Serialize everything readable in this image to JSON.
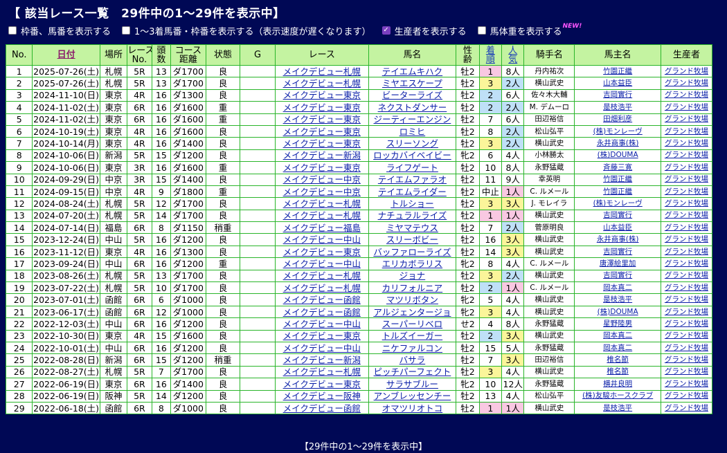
{
  "title": "【 該当レース一覧　29件中の1〜29件を表示中】",
  "options": [
    {
      "label": "枠番、馬番を表示する",
      "checked": false
    },
    {
      "label": "1〜3着馬番・枠番を表示する（表示速度が遅くなります）",
      "checked": false
    },
    {
      "label": "生産者を表示する",
      "checked": true
    },
    {
      "label": "馬体重を表示する",
      "checked": false
    }
  ],
  "new_badge": "NEW!",
  "headers": {
    "no": "No.",
    "date": "日付",
    "place": "場所",
    "race_no_1": "レース",
    "race_no_2": "No.",
    "heads_1": "頭",
    "heads_2": "数",
    "course_1": "コース",
    "course_2": "距離",
    "condition": "状態",
    "grade": "G",
    "race": "レース",
    "horse": "馬名",
    "age_1": "性",
    "age_2": "齢",
    "finish_1": "着",
    "finish_2": "順",
    "pop_1": "人",
    "pop_2": "気",
    "jockey": "騎手名",
    "owner": "馬主名",
    "breeder": "生産者"
  },
  "rows": [
    {
      "no": "1",
      "date": "2025-07-26(土)",
      "place": "札幌",
      "rno": "5R",
      "heads": "13",
      "course": "ダ1700",
      "cond": "良",
      "g": "",
      "race": "メイクデビュー札幌",
      "horse": "テイエムキハク",
      "age": "牡2",
      "finish": "1",
      "rank": "1",
      "pop": "8人",
      "pr": "",
      "jockey": "丹内祐次",
      "owner": "竹園正繼",
      "breeder": "グランド牧場"
    },
    {
      "no": "2",
      "date": "2025-07-26(土)",
      "place": "札幌",
      "rno": "5R",
      "heads": "13",
      "course": "ダ1700",
      "cond": "良",
      "g": "",
      "race": "メイクデビュー札幌",
      "horse": "ミヤエスケープ",
      "age": "牡2",
      "finish": "3",
      "rank": "3",
      "pop": "2人",
      "pr": "2",
      "jockey": "横山武史",
      "owner": "山本益臣",
      "breeder": "グランド牧場"
    },
    {
      "no": "3",
      "date": "2024-11-10(日)",
      "place": "東京",
      "rno": "4R",
      "heads": "16",
      "course": "ダ1300",
      "cond": "良",
      "g": "",
      "race": "メイクデビュー東京",
      "horse": "ビーターライズ",
      "age": "牡2",
      "finish": "2",
      "rank": "2",
      "pop": "6人",
      "pr": "",
      "jockey": "佐々木大輔",
      "owner": "吉岡實行",
      "breeder": "グランド牧場"
    },
    {
      "no": "4",
      "date": "2024-11-02(土)",
      "place": "東京",
      "rno": "6R",
      "heads": "16",
      "course": "ダ1600",
      "cond": "重",
      "g": "",
      "race": "メイクデビュー東京",
      "horse": "ネクストダンサー",
      "age": "牡2",
      "finish": "2",
      "rank": "2",
      "pop": "2人",
      "pr": "2",
      "jockey": "M. デムーロ",
      "owner": "是枝浩平",
      "breeder": "グランド牧場"
    },
    {
      "no": "5",
      "date": "2024-11-02(土)",
      "place": "東京",
      "rno": "6R",
      "heads": "16",
      "course": "ダ1600",
      "cond": "重",
      "g": "",
      "race": "メイクデビュー東京",
      "horse": "ジーティーエンジン",
      "age": "牡2",
      "finish": "7",
      "rank": "",
      "pop": "6人",
      "pr": "",
      "jockey": "田辺裕信",
      "owner": "田畑利彦",
      "breeder": "グランド牧場"
    },
    {
      "no": "6",
      "date": "2024-10-19(土)",
      "place": "東京",
      "rno": "4R",
      "heads": "16",
      "course": "ダ1600",
      "cond": "良",
      "g": "",
      "race": "メイクデビュー東京",
      "horse": "ロミヒ",
      "age": "牡2",
      "finish": "8",
      "rank": "",
      "pop": "2人",
      "pr": "2",
      "jockey": "松山弘平",
      "owner": "(株)モンレーヴ",
      "breeder": "グランド牧場"
    },
    {
      "no": "7",
      "date": "2024-10-14(月)",
      "place": "東京",
      "rno": "4R",
      "heads": "16",
      "course": "ダ1400",
      "cond": "良",
      "g": "",
      "race": "メイクデビュー東京",
      "horse": "スリーソング",
      "age": "牡2",
      "finish": "3",
      "rank": "3",
      "pop": "2人",
      "pr": "2",
      "jockey": "横山武史",
      "owner": "永井商事(株)",
      "breeder": "グランド牧場"
    },
    {
      "no": "8",
      "date": "2024-10-06(日)",
      "place": "新潟",
      "rno": "5R",
      "heads": "15",
      "course": "ダ1200",
      "cond": "良",
      "g": "",
      "race": "メイクデビュー新潟",
      "horse": "ロッカバイベイビー",
      "age": "牝2",
      "finish": "6",
      "rank": "",
      "pop": "4人",
      "pr": "",
      "jockey": "小林勝太",
      "owner": "(株)DOUMA",
      "breeder": "グランド牧場"
    },
    {
      "no": "9",
      "date": "2024-10-06(日)",
      "place": "東京",
      "rno": "3R",
      "heads": "16",
      "course": "ダ1600",
      "cond": "重",
      "g": "",
      "race": "メイクデビュー東京",
      "horse": "ライフゲート",
      "age": "牡2",
      "finish": "10",
      "rank": "",
      "pop": "8人",
      "pr": "",
      "jockey": "永野猛蔵",
      "owner": "斉藤三寛",
      "breeder": "グランド牧場"
    },
    {
      "no": "10",
      "date": "2024-09-29(日)",
      "place": "中京",
      "rno": "3R",
      "heads": "15",
      "course": "ダ1400",
      "cond": "良",
      "g": "",
      "race": "メイクデビュー中京",
      "horse": "テイエムファラオ",
      "age": "牡2",
      "finish": "11",
      "rank": "",
      "pop": "9人",
      "pr": "",
      "jockey": "幸英明",
      "owner": "竹園正繼",
      "breeder": "グランド牧場"
    },
    {
      "no": "11",
      "date": "2024-09-15(日)",
      "place": "中京",
      "rno": "4R",
      "heads": "9",
      "course": "ダ1800",
      "cond": "重",
      "g": "",
      "race": "メイクデビュー中京",
      "horse": "テイエムライダー",
      "age": "牡2",
      "finish": "中止",
      "rank": "",
      "pop": "1人",
      "pr": "1",
      "jockey": "C. ルメール",
      "owner": "竹園正繼",
      "breeder": "グランド牧場"
    },
    {
      "no": "12",
      "date": "2024-08-24(土)",
      "place": "札幌",
      "rno": "5R",
      "heads": "12",
      "course": "ダ1700",
      "cond": "良",
      "g": "",
      "race": "メイクデビュー札幌",
      "horse": "トルショー",
      "age": "牡2",
      "finish": "3",
      "rank": "3",
      "pop": "3人",
      "pr": "3",
      "jockey": "J. モレイラ",
      "owner": "(株)モンレーヴ",
      "breeder": "グランド牧場"
    },
    {
      "no": "13",
      "date": "2024-07-20(土)",
      "place": "札幌",
      "rno": "5R",
      "heads": "14",
      "course": "ダ1700",
      "cond": "良",
      "g": "",
      "race": "メイクデビュー札幌",
      "horse": "ナチュラルライズ",
      "age": "牡2",
      "finish": "1",
      "rank": "1",
      "pop": "1人",
      "pr": "1",
      "jockey": "横山武史",
      "owner": "吉岡實行",
      "breeder": "グランド牧場"
    },
    {
      "no": "14",
      "date": "2024-07-14(日)",
      "place": "福島",
      "rno": "6R",
      "heads": "8",
      "course": "ダ1150",
      "cond": "稍重",
      "g": "",
      "race": "メイクデビュー福島",
      "horse": "ミヤマテウス",
      "age": "牡2",
      "finish": "7",
      "rank": "",
      "pop": "2人",
      "pr": "2",
      "jockey": "菅原明良",
      "owner": "山本益臣",
      "breeder": "グランド牧場"
    },
    {
      "no": "15",
      "date": "2023-12-24(日)",
      "place": "中山",
      "rno": "5R",
      "heads": "16",
      "course": "ダ1200",
      "cond": "良",
      "g": "",
      "race": "メイクデビュー中山",
      "horse": "スリーボビー",
      "age": "牡2",
      "finish": "16",
      "rank": "",
      "pop": "3人",
      "pr": "3",
      "jockey": "横山武史",
      "owner": "永井商事(株)",
      "breeder": "グランド牧場"
    },
    {
      "no": "16",
      "date": "2023-11-12(日)",
      "place": "東京",
      "rno": "4R",
      "heads": "16",
      "course": "ダ1300",
      "cond": "良",
      "g": "",
      "race": "メイクデビュー東京",
      "horse": "バッファローライズ",
      "age": "牡2",
      "finish": "14",
      "rank": "",
      "pop": "3人",
      "pr": "3",
      "jockey": "横山武史",
      "owner": "吉岡實行",
      "breeder": "グランド牧場"
    },
    {
      "no": "17",
      "date": "2023-09-24(日)",
      "place": "中山",
      "rno": "6R",
      "heads": "16",
      "course": "ダ1200",
      "cond": "重",
      "g": "",
      "race": "メイクデビュー中山",
      "horse": "エリカボラリス",
      "age": "牝2",
      "finish": "8",
      "rank": "",
      "pop": "4人",
      "pr": "",
      "jockey": "C. ルメール",
      "owner": "唐澤絵里加",
      "breeder": "グランド牧場"
    },
    {
      "no": "18",
      "date": "2023-08-26(土)",
      "place": "札幌",
      "rno": "5R",
      "heads": "13",
      "course": "ダ1700",
      "cond": "良",
      "g": "",
      "race": "メイクデビュー札幌",
      "horse": "ジョナ",
      "age": "牡2",
      "finish": "3",
      "rank": "3",
      "pop": "2人",
      "pr": "2",
      "jockey": "横山武史",
      "owner": "吉岡實行",
      "breeder": "グランド牧場"
    },
    {
      "no": "19",
      "date": "2023-07-22(土)",
      "place": "札幌",
      "rno": "5R",
      "heads": "10",
      "course": "ダ1700",
      "cond": "良",
      "g": "",
      "race": "メイクデビュー札幌",
      "horse": "カリフォルニア",
      "age": "牡2",
      "finish": "2",
      "rank": "2",
      "pop": "1人",
      "pr": "1",
      "jockey": "C. ルメール",
      "owner": "岡本真二",
      "breeder": "グランド牧場"
    },
    {
      "no": "20",
      "date": "2023-07-01(土)",
      "place": "函館",
      "rno": "6R",
      "heads": "6",
      "course": "ダ1000",
      "cond": "良",
      "g": "",
      "race": "メイクデビュー函館",
      "horse": "マツリボタン",
      "age": "牝2",
      "finish": "5",
      "rank": "",
      "pop": "4人",
      "pr": "",
      "jockey": "横山武史",
      "owner": "是枝浩平",
      "breeder": "グランド牧場"
    },
    {
      "no": "21",
      "date": "2023-06-17(土)",
      "place": "函館",
      "rno": "6R",
      "heads": "12",
      "course": "ダ1000",
      "cond": "良",
      "g": "",
      "race": "メイクデビュー函館",
      "horse": "アルジェンタージョ",
      "age": "牝2",
      "finish": "3",
      "rank": "3",
      "pop": "4人",
      "pr": "",
      "jockey": "横山武史",
      "owner": "(株)DOUMA",
      "breeder": "グランド牧場"
    },
    {
      "no": "22",
      "date": "2022-12-03(土)",
      "place": "中山",
      "rno": "6R",
      "heads": "16",
      "course": "ダ1200",
      "cond": "良",
      "g": "",
      "race": "メイクデビュー中山",
      "horse": "スーパーリベロ",
      "age": "せ2",
      "finish": "4",
      "rank": "",
      "pop": "8人",
      "pr": "",
      "jockey": "永野猛蔵",
      "owner": "星野陸男",
      "breeder": "グランド牧場"
    },
    {
      "no": "23",
      "date": "2022-10-30(日)",
      "place": "東京",
      "rno": "4R",
      "heads": "15",
      "course": "ダ1600",
      "cond": "良",
      "g": "",
      "race": "メイクデビュー東京",
      "horse": "トルズイーガー",
      "age": "牡2",
      "finish": "2",
      "rank": "2",
      "pop": "3人",
      "pr": "3",
      "jockey": "横山武史",
      "owner": "岡本真二",
      "breeder": "グランド牧場"
    },
    {
      "no": "24",
      "date": "2022-10-01(土)",
      "place": "中山",
      "rno": "6R",
      "heads": "16",
      "course": "ダ1200",
      "cond": "良",
      "g": "",
      "race": "メイクデビュー中山",
      "horse": "ニケファルコン",
      "age": "牡2",
      "finish": "15",
      "rank": "",
      "pop": "5人",
      "pr": "",
      "jockey": "永野猛蔵",
      "owner": "岡本真二",
      "breeder": "グランド牧場"
    },
    {
      "no": "25",
      "date": "2022-08-28(日)",
      "place": "新潟",
      "rno": "6R",
      "heads": "15",
      "course": "ダ1200",
      "cond": "稍重",
      "g": "",
      "race": "メイクデビュー新潟",
      "horse": "バサラ",
      "age": "牡2",
      "finish": "7",
      "rank": "",
      "pop": "3人",
      "pr": "3",
      "jockey": "田辺裕信",
      "owner": "椎名節",
      "breeder": "グランド牧場"
    },
    {
      "no": "26",
      "date": "2022-08-27(土)",
      "place": "札幌",
      "rno": "5R",
      "heads": "7",
      "course": "ダ1700",
      "cond": "良",
      "g": "",
      "race": "メイクデビュー札幌",
      "horse": "ピッチパーフェクト",
      "age": "牡2",
      "finish": "3",
      "rank": "3",
      "pop": "4人",
      "pr": "",
      "jockey": "横山武史",
      "owner": "椎名節",
      "breeder": "グランド牧場"
    },
    {
      "no": "27",
      "date": "2022-06-19(日)",
      "place": "東京",
      "rno": "6R",
      "heads": "16",
      "course": "ダ1400",
      "cond": "良",
      "g": "",
      "race": "メイクデビュー東京",
      "horse": "サラサブルー",
      "age": "牝2",
      "finish": "10",
      "rank": "",
      "pop": "12人",
      "pr": "",
      "jockey": "永野猛蔵",
      "owner": "横井良明",
      "breeder": "グランド牧場"
    },
    {
      "no": "28",
      "date": "2022-06-19(日)",
      "place": "阪神",
      "rno": "5R",
      "heads": "14",
      "course": "ダ1200",
      "cond": "良",
      "g": "",
      "race": "メイクデビュー阪神",
      "horse": "アンブレッセンチー",
      "age": "牡2",
      "finish": "13",
      "rank": "",
      "pop": "4人",
      "pr": "",
      "jockey": "松山弘平",
      "owner": "(株)友駿ホースクラブ",
      "breeder": "グランド牧場"
    },
    {
      "no": "29",
      "date": "2022-06-18(土)",
      "place": "函館",
      "rno": "6R",
      "heads": "8",
      "course": "ダ1000",
      "cond": "良",
      "g": "",
      "race": "メイクデビュー函館",
      "horse": "オマツリオトコ",
      "age": "牡2",
      "finish": "1",
      "rank": "1",
      "pop": "1人",
      "pr": "1",
      "jockey": "横山武史",
      "owner": "是枝浩平",
      "breeder": "グランド牧場"
    }
  ],
  "footer": "【29件中の1〜29件を表示中】",
  "colors": {
    "background": "#000855",
    "header_bg": "#c4f3a1",
    "rank1": "#f9c8e2",
    "rank2": "#bfe0f7",
    "rank3": "#fbf59a",
    "link": "#0a1fa8"
  }
}
